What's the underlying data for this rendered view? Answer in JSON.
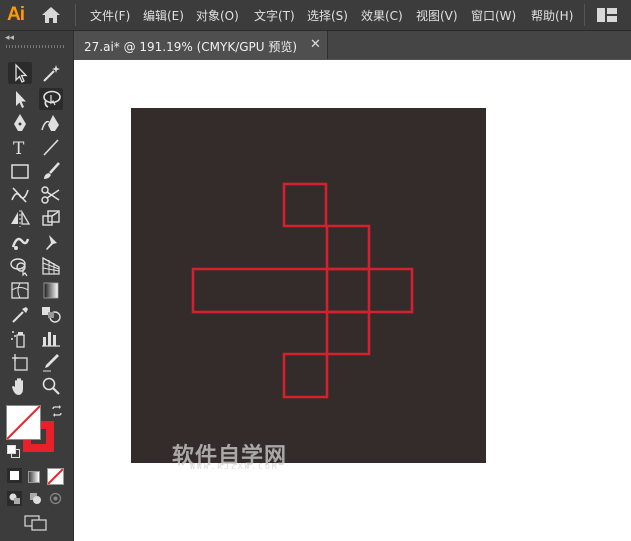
{
  "app": {
    "logo_text": "Ai",
    "logo_color": "#ff9a00",
    "home_icon": "home-icon",
    "workspace_icon": "workspace-switcher-icon"
  },
  "menu": {
    "items": [
      {
        "label": "文件(F)"
      },
      {
        "label": "编辑(E)"
      },
      {
        "label": "对象(O)"
      },
      {
        "label": "文字(T)"
      },
      {
        "label": "选择(S)"
      },
      {
        "label": "效果(C)"
      },
      {
        "label": "视图(V)"
      },
      {
        "label": "窗口(W)"
      },
      {
        "label": "帮助(H)"
      }
    ]
  },
  "toolbar": {
    "collapse_glyph": "◂◂",
    "tools": [
      "selection-tool-icon",
      "magic-wand-tool-icon",
      "direct-selection-tool-icon",
      "lasso-tool-icon",
      "pen-tool-icon",
      "curvature-tool-icon",
      "type-tool-icon",
      "line-segment-tool-icon",
      "rectangle-tool-icon",
      "paintbrush-tool-icon",
      "shaper-tool-icon",
      "scissors-tool-icon",
      "reflect-tool-icon",
      "scale-tool-icon",
      "puppet-warp-tool-icon",
      "pin-tool-icon",
      "shape-builder-tool-icon",
      "perspective-grid-tool-icon",
      "mesh-tool-icon",
      "gradient-tool-icon",
      "eyedropper-tool-icon",
      "blend-tool-icon",
      "symbol-sprayer-tool-icon",
      "column-graph-tool-icon",
      "artboard-tool-icon",
      "slice-tool-icon",
      "hand-tool-icon",
      "zoom-tool-icon"
    ],
    "fill_color": "#ffffff",
    "stroke_color": "#e8202a",
    "swap_icon": "swap-fill-stroke-icon",
    "default_colors_icon": "default-fill-stroke-icon",
    "color_modes": [
      "color-mode-icon",
      "gradient-mode-icon",
      "none-mode-icon"
    ],
    "draw_modes": [
      "draw-normal-icon",
      "draw-behind-icon",
      "draw-inside-icon"
    ],
    "screen_mode_icon": "screen-mode-icon"
  },
  "document": {
    "tab_title": "27.ai*  @ 191.19% (CMYK/GPU 预览)",
    "close_glyph": "✕"
  },
  "artboard": {
    "background_color": "#332c2b",
    "stroke_color": "#d7202e"
  },
  "watermark": {
    "title": "软件自学网",
    "url": "WWW.RJZXW.COM"
  }
}
